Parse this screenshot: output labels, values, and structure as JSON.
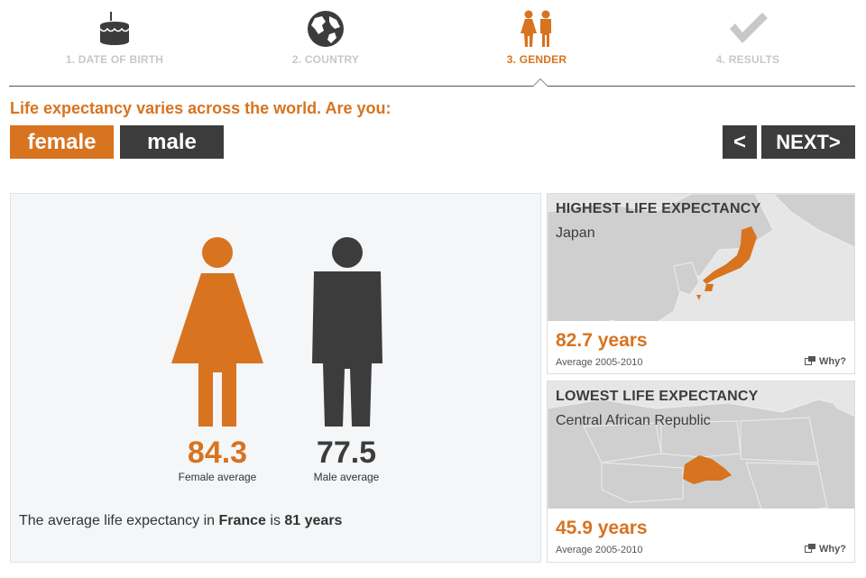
{
  "steps": [
    {
      "label": "1. DATE OF BIRTH",
      "icon": "birthday-cake-icon",
      "state": "inactive"
    },
    {
      "label": "2. COUNTRY",
      "icon": "globe-icon",
      "state": "inactive"
    },
    {
      "label": "3. GENDER",
      "icon": "gender-icon",
      "state": "active"
    },
    {
      "label": "4. RESULTS",
      "icon": "checkmark-icon",
      "state": "inactive"
    }
  ],
  "question": "Life expectancy varies across the world. Are you:",
  "gender_buttons": {
    "female": "female",
    "male": "male"
  },
  "nav": {
    "prev": "<",
    "next": "NEXT>"
  },
  "main": {
    "female_value": "84.3",
    "female_label": "Female average",
    "male_value": "77.5",
    "male_label": "Male average",
    "summary_prefix": "The average life expectancy in ",
    "summary_country": "France",
    "summary_middle": " is ",
    "summary_value": "81 years"
  },
  "highest": {
    "title": "HIGHEST LIFE EXPECTANCY",
    "country": "Japan",
    "years": "82.7 years",
    "period": "Average 2005-2010",
    "why": "Why?"
  },
  "lowest": {
    "title": "LOWEST LIFE EXPECTANCY",
    "country": "Central African Republic",
    "years": "45.9 years",
    "period": "Average 2005-2010",
    "why": "Why?"
  },
  "colors": {
    "accent": "#d8731f",
    "dark": "#3c3c3c",
    "inactive": "#c8c8c8",
    "map_land": "#cfcfcf",
    "map_water": "#e6e6e6"
  }
}
